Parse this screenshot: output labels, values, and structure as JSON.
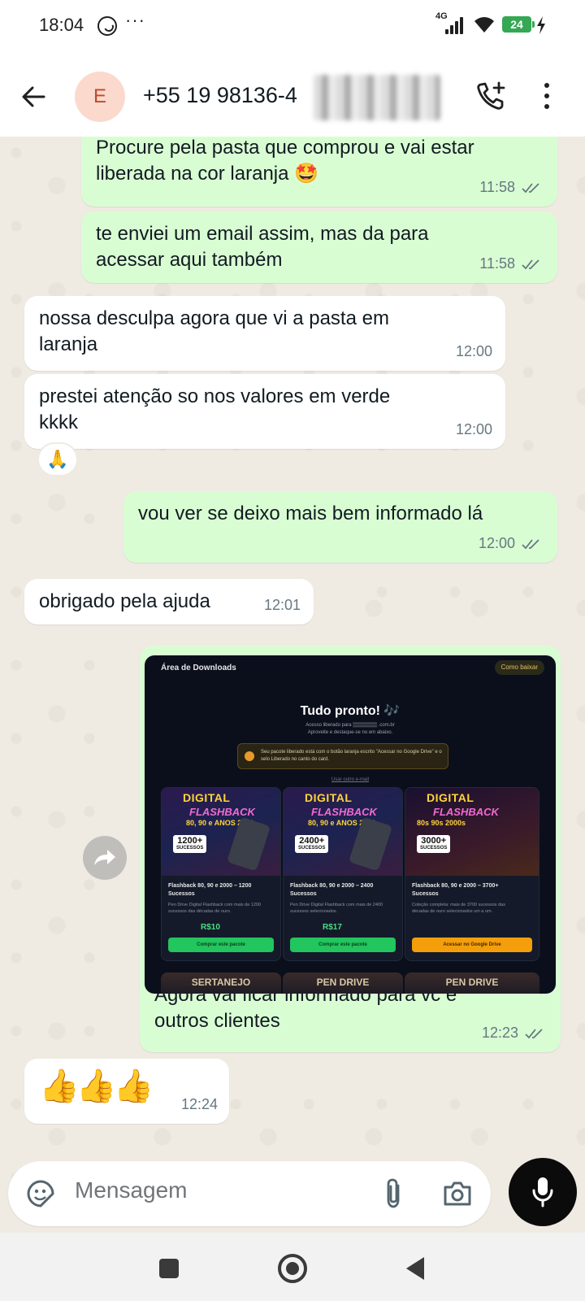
{
  "status_bar": {
    "time": "18:04",
    "more": "···",
    "network": "4G",
    "battery": "24"
  },
  "header": {
    "avatar_letter": "E",
    "contact_name": "+55 19 98136-4"
  },
  "messages": [
    {
      "side": "out",
      "lines": [
        "Procure pela pasta que comprou e vai estar",
        "liberada na cor laranja 🤩"
      ],
      "time": "11:58"
    },
    {
      "side": "out",
      "lines": [
        "te enviei um email assim, mas da para",
        "acessar aqui também"
      ],
      "time": "11:58"
    },
    {
      "side": "in",
      "lines": [
        "nossa desculpa agora que vi a pasta em",
        "laranja"
      ],
      "time": "12:00"
    },
    {
      "side": "in",
      "lines": [
        "prestei atenção so nos valores em verde",
        "kkkk"
      ],
      "time": "12:00",
      "reaction": "🙏"
    },
    {
      "side": "out",
      "lines": [
        "vou ver se deixo mais bem informado lá"
      ],
      "time": "12:00"
    },
    {
      "side": "in",
      "lines": [
        "obrigado pela ajuda"
      ],
      "time": "12:01"
    },
    {
      "side": "out",
      "lines": [
        "Agora vai ficar informado para vc e",
        "outros clientes"
      ],
      "time": "12:23"
    },
    {
      "side": "in",
      "lines": [
        "👍👍👍"
      ],
      "time": "12:24"
    }
  ],
  "embedded_image": {
    "header_title": "Área de Downloads",
    "header_button": "Como baixar",
    "title": "Tudo pronto! 🎶",
    "subtitle_1": "Acesso liberado para",
    "subtitle_2": ".com.br",
    "subtitle_3": "Aproveite e destaque-se no",
    "subtitle_4": "em abaixo.",
    "notice": "Seu pacote liberado está com o botão laranja escrito \"Acessar no Google Drive\" e o selo Liberado no canto do card.",
    "link": "Usar outro e-mail",
    "cards": [
      {
        "art_title": "DIGITAL",
        "art_sub": "FLASHBACK",
        "art_years": "80, 90 e ANOS 2000",
        "badge": "1200+",
        "badge_sub": "SUCESSOS",
        "name": "Flashback 80, 90 e 2000 – 1200 Sucessos",
        "desc": "Pen Drive Digital Flashback com mais de 1200 sucessos das décadas de ouro.",
        "price": "R$10",
        "button": "Comprar este pacote",
        "bottom": "SERTANEJO"
      },
      {
        "art_title": "DIGITAL",
        "art_sub": "FLASHBACK",
        "art_years": "80, 90 e ANOS 2000",
        "badge": "2400+",
        "badge_sub": "SUCESSOS",
        "name": "Flashback 80, 90 e 2000 – 2400 Sucessos",
        "desc": "Pen Drive Digital Flashback com mais de 2400 sucessos selecionados.",
        "price": "R$17",
        "button": "Comprar este pacote",
        "bottom": "PEN DRIVE"
      },
      {
        "art_title": "DIGITAL",
        "art_sub": "FLASHBACK",
        "art_years": "80s 90s 2000s",
        "badge": "3000+",
        "badge_sub": "SUCESSOS",
        "name": "Flashback 80, 90 e 2000 – 3700+ Sucessos",
        "desc": "Coleção completa: mais de 3700 sucessos das décadas de ouro selecionados um a um.",
        "price": "",
        "button": "Acessar no Google Drive",
        "bottom": "PEN DRIVE"
      }
    ]
  },
  "input": {
    "placeholder": "Mensagem"
  },
  "colors": {
    "outgoing": "#d9fdd3",
    "incoming": "#ffffff",
    "chat_bg": "#efeae2",
    "ticks": "#667781"
  }
}
